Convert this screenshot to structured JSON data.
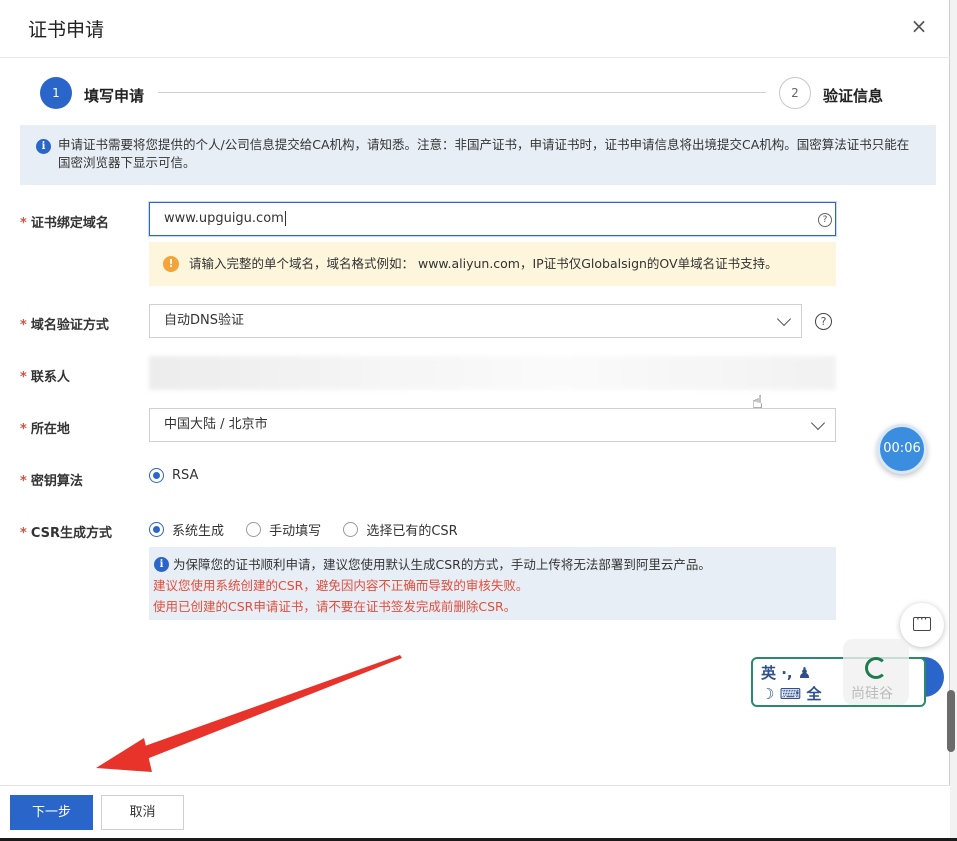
{
  "dialog": {
    "title": "证书申请",
    "close_icon": "×"
  },
  "steps": [
    {
      "number": "1",
      "label": "填写申请",
      "state": "active"
    },
    {
      "number": "2",
      "label": "验证信息",
      "state": "pending"
    }
  ],
  "notice": {
    "text": "申请证书需要将您提供的个人/公司信息提交给CA机构，请知悉。注意：非国产证书，申请证书时，证书申请信息将出境提交CA机构。国密算法证书只能在国密浏览器下显示可信。"
  },
  "form": {
    "required_mark": "*",
    "domain": {
      "label": "证书绑定域名",
      "value": "www.upguigu.com",
      "help": "?",
      "warning": "请输入完整的单个域名，域名格式例如： www.aliyun.com，IP证书仅Globalsign的OV单域名证书支持。",
      "warning_icon": "!"
    },
    "verify_method": {
      "label": "域名验证方式",
      "value": "自动DNS验证",
      "help": "?"
    },
    "contact": {
      "label": "联系人"
    },
    "location": {
      "label": "所在地",
      "value": "中国大陆 / 北京市"
    },
    "algorithm": {
      "label": "密钥算法",
      "options": [
        {
          "label": "RSA",
          "selected": true
        }
      ]
    },
    "csr": {
      "label": "CSR生成方式",
      "options": [
        {
          "label": "系统生成",
          "selected": true
        },
        {
          "label": "手动填写",
          "selected": false
        },
        {
          "label": "选择已有的CSR",
          "selected": false
        }
      ],
      "note_line1": "为保障您的证书顺利申请，建议您使用默认生成CSR的方式，手动上传将无法部署到阿里云产品。",
      "note_line2": "建议您使用系统创建的CSR，避免因内容不正确而导致的审核失败。",
      "note_line3": "使用已创建的CSR申请证书，请不要在证书签发完成前删除CSR。"
    }
  },
  "overlay": {
    "timer": "00:06",
    "ime_line1": "英 ·, ♟",
    "ime_line2": "☽ ⌨ 全",
    "ime_watermark": "尚硅谷"
  },
  "footer": {
    "next_label": "下一步",
    "cancel_label": "取消"
  },
  "colors": {
    "primary": "#2a66c9",
    "required": "#e34d3b",
    "warning_bg": "#fdf5dc",
    "info_bg": "#e8eef6",
    "arrow": "#e8332b"
  }
}
